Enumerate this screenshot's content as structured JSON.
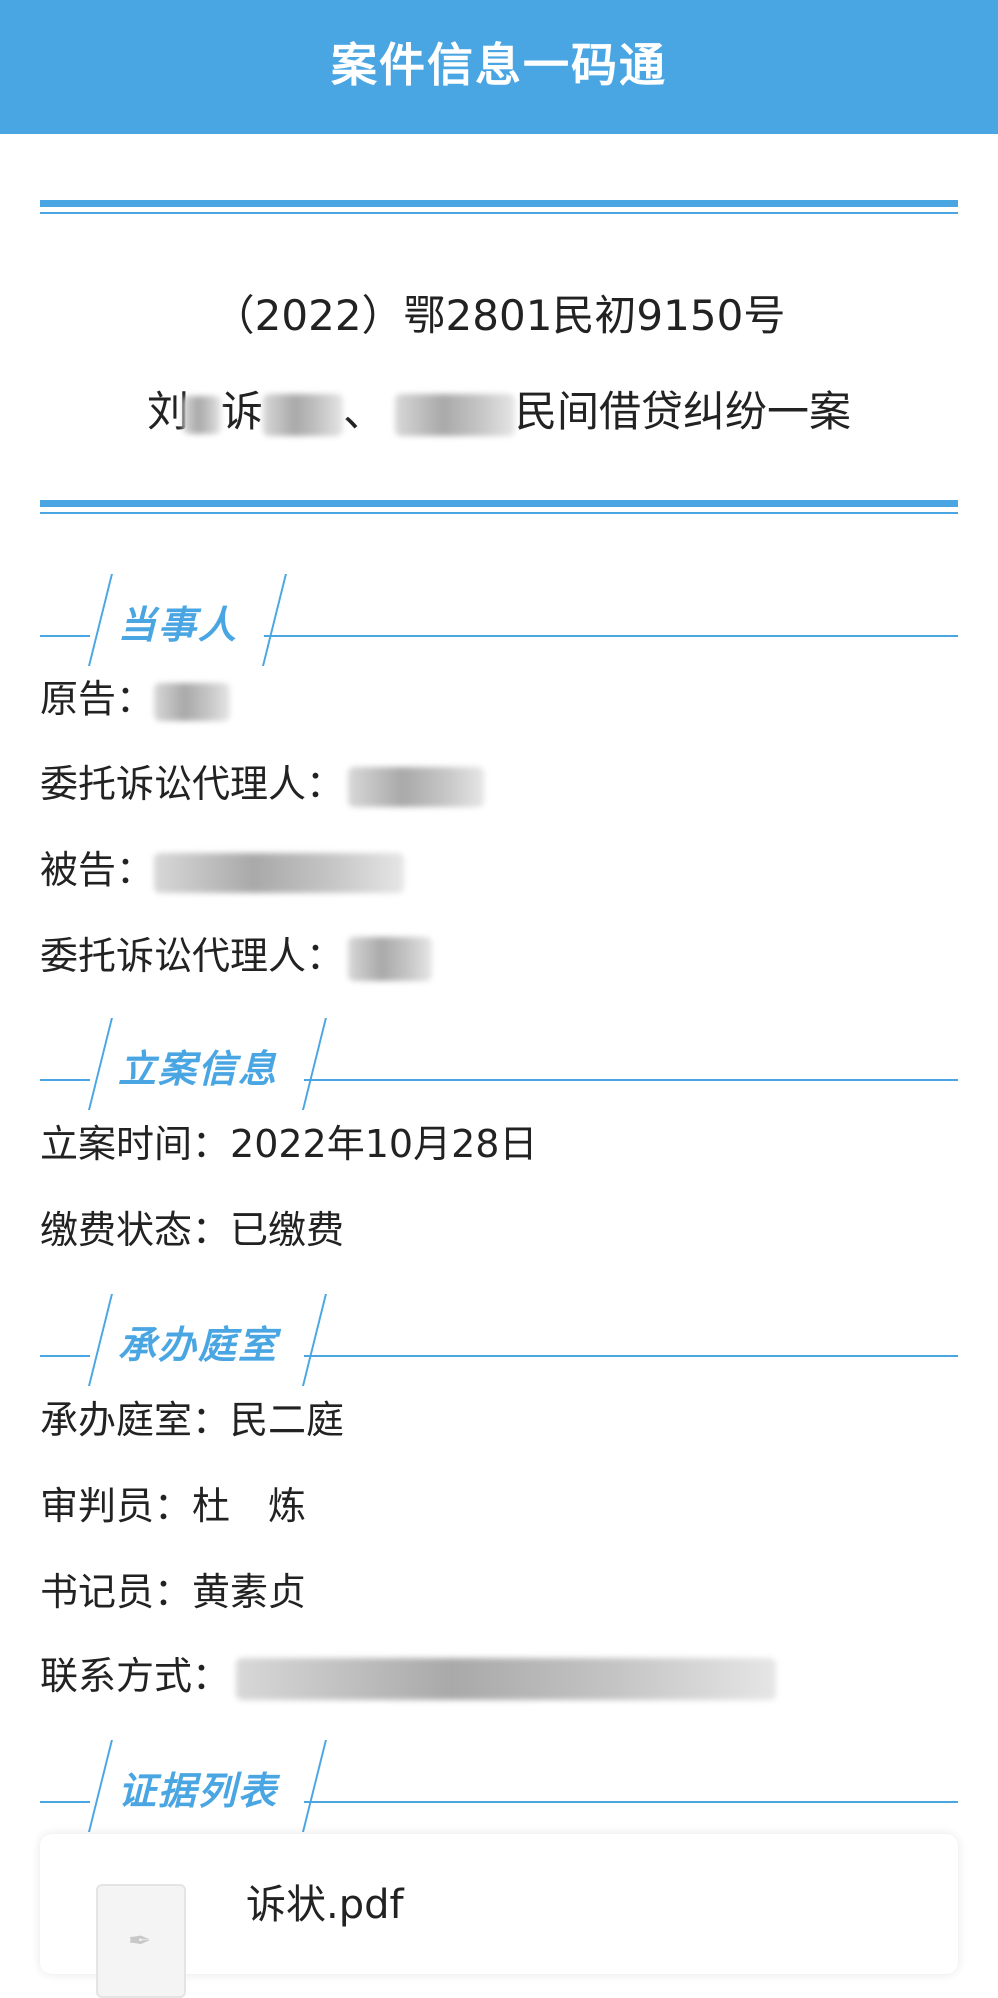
{
  "header": {
    "title": "案件信息一码通"
  },
  "case": {
    "number": "（2022）鄂2801民初9150号",
    "name_prefix": "刘",
    "name_sue": "诉",
    "name_sep": "、",
    "name_suffix": "民间借贷纠纷一案"
  },
  "sections": {
    "parties": {
      "title": "当事人",
      "plaintiff_label": "原告：",
      "plaintiff_agent_label": "委托诉讼代理人：",
      "defendant_label": "被告：",
      "defendant_agent_label": "委托诉讼代理人："
    },
    "filing": {
      "title": "立案信息",
      "date_label": "立案时间：",
      "date_value": "2022年10月28日",
      "fee_label": "缴费状态：",
      "fee_value": "已缴费"
    },
    "court": {
      "title": "承办庭室",
      "division_label": "承办庭室：",
      "division_value": "民二庭",
      "judge_label": "审判员：",
      "judge_value": "杜　炼",
      "clerk_label": "书记员：",
      "clerk_value": "黄素贞",
      "contact_label": "联系方式："
    },
    "evidence": {
      "title": "证据列表",
      "files": [
        {
          "name": "诉状.pdf"
        }
      ]
    }
  },
  "colors": {
    "accent": "#4aa6e2"
  },
  "icons": {
    "file": "pdf-file-icon"
  }
}
